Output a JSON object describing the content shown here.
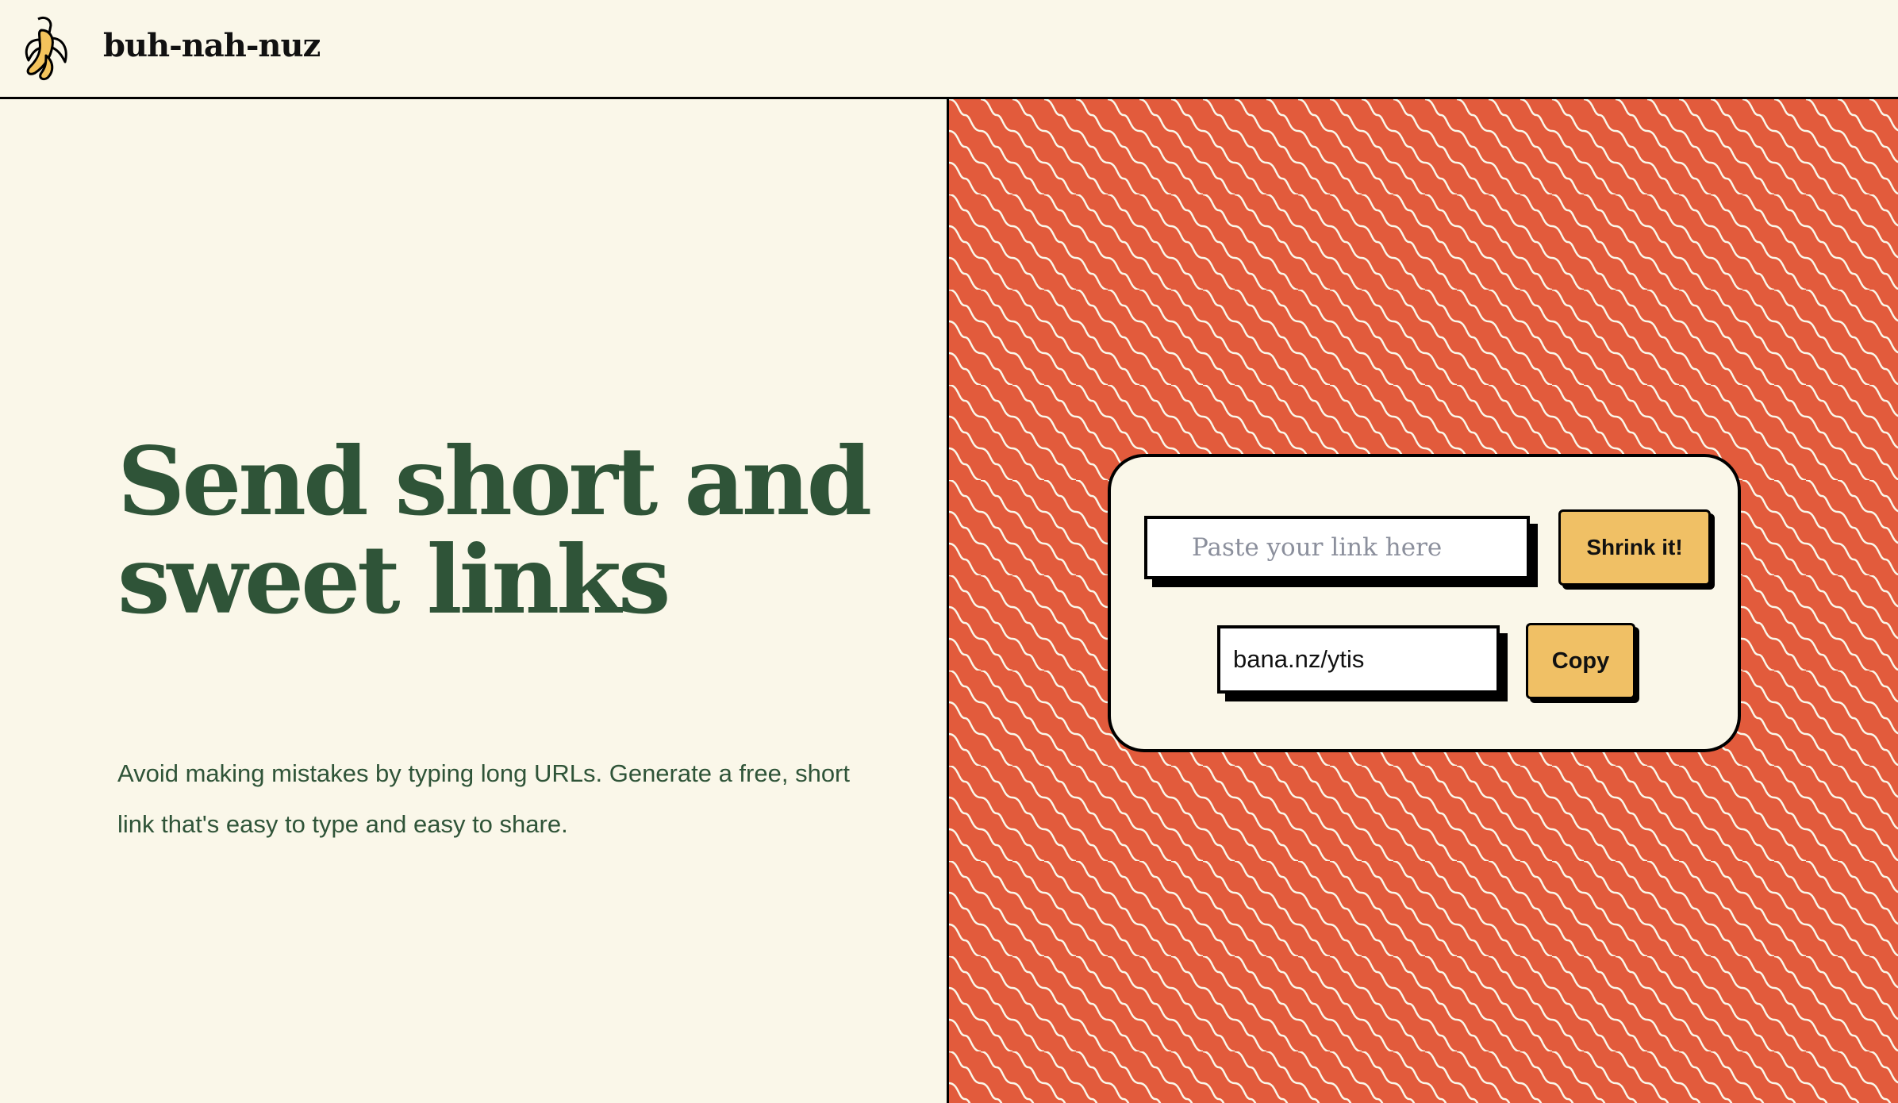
{
  "header": {
    "logo_icon": "banana-icon",
    "brand_name": "buh-nah-nuz"
  },
  "hero": {
    "title": "Send short and sweet links",
    "subtitle": "Avoid making mistakes by typing long URLs. Generate a free, short link that's easy to type and easy to share."
  },
  "shortener": {
    "link_input_value": "",
    "link_input_placeholder": "Paste your link here",
    "shrink_label": "Shrink it!",
    "short_link_value": "bana.nz/ytis",
    "copy_label": "Copy"
  },
  "colors": {
    "background": "#faf7e9",
    "heading_green": "#2f5438",
    "pattern_orange": "#e25b3c",
    "button_yellow": "#f0c065",
    "banana_yellow": "#f3c35c"
  }
}
